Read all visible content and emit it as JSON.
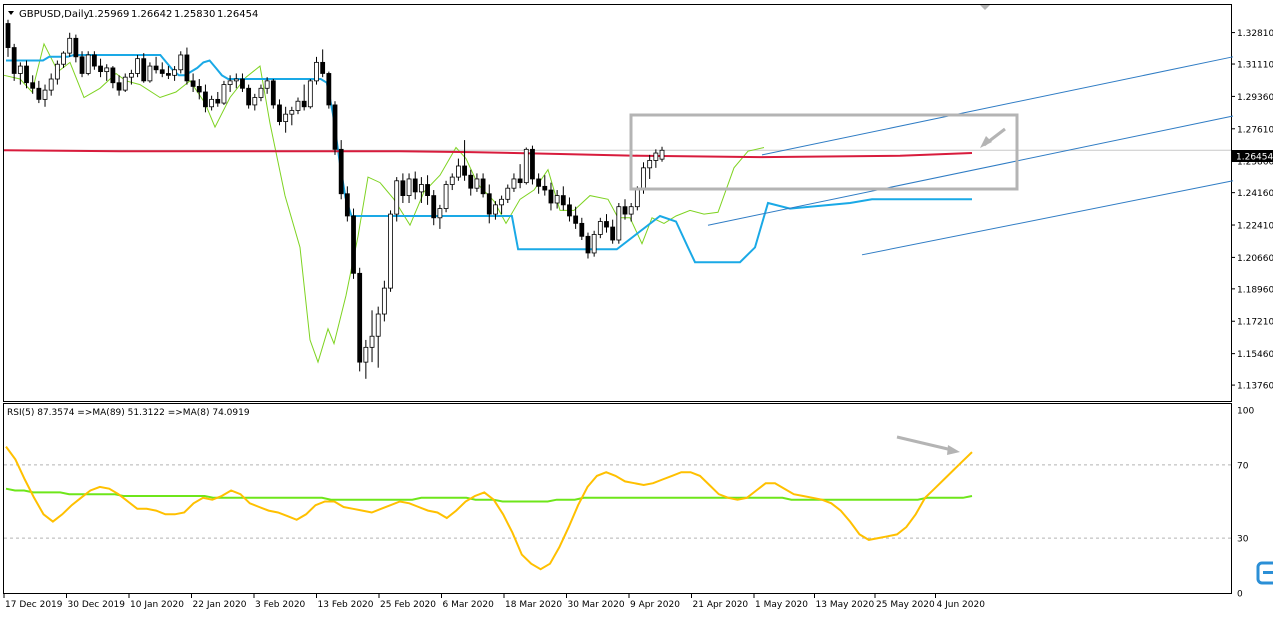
{
  "colors": {
    "background": "#ffffff",
    "frame": "#000000",
    "candle_up_fill": "#ffffff",
    "candle_down_fill": "#000000",
    "candle_outline": "#000000",
    "ma_red": "#d81b3c",
    "channel_cyan": "#1aa9e6",
    "green_line": "#7ed321",
    "trend_blue": "#2f7cc4",
    "rsi_line": "#ffc000",
    "rsi_ma": "#6ee61a",
    "box": "#b4b4b4",
    "arrow": "#b4b4b4",
    "price_badge_bg": "#000000",
    "price_badge_text": "#ffffff",
    "hline": "#c8c8c8"
  },
  "chart_data": [
    {
      "type": "candlestick",
      "title": "GBPUSD,Daily",
      "ohlc_header": [
        "1.25969",
        "1.26642",
        "1.25830",
        "1.26454"
      ],
      "ylim": [
        1.129,
        1.343
      ],
      "y_ticks": [
        "1.32810",
        "1.31110",
        "1.29360",
        "1.27610",
        "1.25860",
        "1.24160",
        "1.22410",
        "1.20660",
        "1.18960",
        "1.17210",
        "1.15460",
        "1.13760"
      ],
      "current_price": "1.26454",
      "x_ticks": [
        "17 Dec 2019",
        "30 Dec 2019",
        "10 Jan 2020",
        "22 Jan 2020",
        "3 Feb 2020",
        "13 Feb 2020",
        "25 Feb 2020",
        "6 Mar 2020",
        "18 Mar 2020",
        "30 Mar 2020",
        "9 Apr 2020",
        "21 Apr 2020",
        "1 May 2020",
        "13 May 2020",
        "25 May 2020",
        "4 Jun 2020"
      ],
      "candles_ohlc": [
        [
          1.333,
          1.335,
          1.315,
          1.32
        ],
        [
          1.32,
          1.322,
          1.302,
          1.306
        ],
        [
          1.306,
          1.312,
          1.3,
          1.31
        ],
        [
          1.31,
          1.313,
          1.298,
          1.301
        ],
        [
          1.301,
          1.305,
          1.295,
          1.298
        ],
        [
          1.298,
          1.302,
          1.29,
          1.292
        ],
        [
          1.292,
          1.3,
          1.288,
          1.297
        ],
        [
          1.297,
          1.306,
          1.294,
          1.303
        ],
        [
          1.303,
          1.313,
          1.3,
          1.311
        ],
        [
          1.311,
          1.318,
          1.309,
          1.317
        ],
        [
          1.317,
          1.328,
          1.315,
          1.325
        ],
        [
          1.325,
          1.327,
          1.312,
          1.315
        ],
        [
          1.315,
          1.318,
          1.304,
          1.306
        ],
        [
          1.306,
          1.318,
          1.305,
          1.316
        ],
        [
          1.316,
          1.318,
          1.308,
          1.31
        ],
        [
          1.31,
          1.314,
          1.304,
          1.307
        ],
        [
          1.307,
          1.311,
          1.302,
          1.309
        ],
        [
          1.309,
          1.31,
          1.298,
          1.301
        ],
        [
          1.301,
          1.305,
          1.294,
          1.297
        ],
        [
          1.297,
          1.306,
          1.296,
          1.304
        ],
        [
          1.304,
          1.308,
          1.3,
          1.306
        ],
        [
          1.306,
          1.316,
          1.304,
          1.314
        ],
        [
          1.314,
          1.317,
          1.301,
          1.302
        ],
        [
          1.302,
          1.312,
          1.301,
          1.31
        ],
        [
          1.31,
          1.315,
          1.306,
          1.308
        ],
        [
          1.308,
          1.312,
          1.304,
          1.306
        ],
        [
          1.306,
          1.31,
          1.303,
          1.305
        ],
        [
          1.305,
          1.31,
          1.302,
          1.308
        ],
        [
          1.308,
          1.318,
          1.306,
          1.316
        ],
        [
          1.316,
          1.32,
          1.3,
          1.302
        ],
        [
          1.302,
          1.306,
          1.296,
          1.299
        ],
        [
          1.299,
          1.303,
          1.292,
          1.296
        ],
        [
          1.296,
          1.3,
          1.285,
          1.288
        ],
        [
          1.288,
          1.294,
          1.286,
          1.292
        ],
        [
          1.292,
          1.296,
          1.288,
          1.29
        ],
        [
          1.29,
          1.302,
          1.289,
          1.3
        ],
        [
          1.3,
          1.305,
          1.296,
          1.302
        ],
        [
          1.302,
          1.306,
          1.298,
          1.303
        ],
        [
          1.303,
          1.306,
          1.296,
          1.298
        ],
        [
          1.298,
          1.3,
          1.287,
          1.289
        ],
        [
          1.289,
          1.295,
          1.286,
          1.293
        ],
        [
          1.293,
          1.3,
          1.291,
          1.298
        ],
        [
          1.298,
          1.304,
          1.295,
          1.302
        ],
        [
          1.302,
          1.303,
          1.287,
          1.289
        ],
        [
          1.289,
          1.292,
          1.278,
          1.28
        ],
        [
          1.28,
          1.288,
          1.274,
          1.284
        ],
        [
          1.284,
          1.288,
          1.278,
          1.286
        ],
        [
          1.286,
          1.293,
          1.284,
          1.291
        ],
        [
          1.291,
          1.3,
          1.286,
          1.288
        ],
        [
          1.288,
          1.303,
          1.287,
          1.302
        ],
        [
          1.302,
          1.315,
          1.3,
          1.312
        ],
        [
          1.312,
          1.319,
          1.304,
          1.306
        ],
        [
          1.306,
          1.307,
          1.287,
          1.289
        ],
        [
          1.289,
          1.291,
          1.262,
          1.265
        ],
        [
          1.265,
          1.27,
          1.238,
          1.241
        ],
        [
          1.241,
          1.245,
          1.226,
          1.229
        ],
        [
          1.229,
          1.233,
          1.195,
          1.198
        ],
        [
          1.198,
          1.201,
          1.145,
          1.15
        ],
        [
          1.15,
          1.162,
          1.141,
          1.158
        ],
        [
          1.158,
          1.178,
          1.15,
          1.164
        ],
        [
          1.164,
          1.18,
          1.147,
          1.176
        ],
        [
          1.176,
          1.194,
          1.172,
          1.19
        ],
        [
          1.19,
          1.232,
          1.188,
          1.23
        ],
        [
          1.23,
          1.25,
          1.226,
          1.248
        ],
        [
          1.248,
          1.252,
          1.236,
          1.24
        ],
        [
          1.24,
          1.252,
          1.236,
          1.249
        ],
        [
          1.249,
          1.253,
          1.238,
          1.242
        ],
        [
          1.242,
          1.25,
          1.236,
          1.246
        ],
        [
          1.246,
          1.251,
          1.235,
          1.24
        ],
        [
          1.24,
          1.243,
          1.224,
          1.228
        ],
        [
          1.228,
          1.235,
          1.222,
          1.233
        ],
        [
          1.233,
          1.248,
          1.231,
          1.246
        ],
        [
          1.246,
          1.252,
          1.243,
          1.25
        ],
        [
          1.25,
          1.26,
          1.248,
          1.256
        ],
        [
          1.256,
          1.27,
          1.248,
          1.251
        ],
        [
          1.251,
          1.254,
          1.24,
          1.244
        ],
        [
          1.244,
          1.252,
          1.242,
          1.249
        ],
        [
          1.249,
          1.252,
          1.239,
          1.241
        ],
        [
          1.241,
          1.246,
          1.225,
          1.23
        ],
        [
          1.23,
          1.237,
          1.227,
          1.235
        ],
        [
          1.235,
          1.24,
          1.23,
          1.238
        ],
        [
          1.238,
          1.246,
          1.236,
          1.244
        ],
        [
          1.244,
          1.252,
          1.242,
          1.249
        ],
        [
          1.249,
          1.257,
          1.244,
          1.247
        ],
        [
          1.247,
          1.266,
          1.246,
          1.265
        ],
        [
          1.265,
          1.267,
          1.246,
          1.249
        ],
        [
          1.249,
          1.252,
          1.241,
          1.245
        ],
        [
          1.245,
          1.251,
          1.24,
          1.243
        ],
        [
          1.243,
          1.247,
          1.232,
          1.236
        ],
        [
          1.236,
          1.243,
          1.233,
          1.24
        ],
        [
          1.24,
          1.245,
          1.232,
          1.235
        ],
        [
          1.235,
          1.239,
          1.226,
          1.229
        ],
        [
          1.229,
          1.234,
          1.222,
          1.225
        ],
        [
          1.225,
          1.228,
          1.216,
          1.218
        ],
        [
          1.218,
          1.22,
          1.206,
          1.209
        ],
        [
          1.209,
          1.221,
          1.207,
          1.219
        ],
        [
          1.219,
          1.228,
          1.217,
          1.226
        ],
        [
          1.226,
          1.23,
          1.22,
          1.223
        ],
        [
          1.223,
          1.227,
          1.214,
          1.216
        ],
        [
          1.216,
          1.236,
          1.214,
          1.234
        ],
        [
          1.234,
          1.238,
          1.227,
          1.23
        ],
        [
          1.23,
          1.236,
          1.226,
          1.234
        ],
        [
          1.234,
          1.245,
          1.232,
          1.243
        ],
        [
          1.243,
          1.258,
          1.241,
          1.255
        ],
        [
          1.255,
          1.262,
          1.249,
          1.259
        ],
        [
          1.259,
          1.265,
          1.255,
          1.263
        ],
        [
          1.2597,
          1.2664,
          1.2583,
          1.2645
        ]
      ],
      "ma_red": [
        1.2645,
        1.264,
        1.264,
        1.264,
        1.2625,
        1.2625,
        1.2625,
        1.261,
        1.261,
        1.261
      ],
      "channel_cyan": [
        1.313,
        1.313,
        1.313,
        1.313,
        1.313,
        1.313,
        1.313,
        1.315,
        1.315,
        1.315,
        1.315,
        1.316,
        1.316,
        1.316,
        1.316,
        1.316,
        1.316,
        1.316,
        1.316,
        1.316,
        1.316,
        1.316,
        1.316,
        1.316,
        1.316,
        1.316,
        1.312,
        1.308,
        1.305,
        1.305,
        1.307,
        1.309,
        1.312,
        1.313,
        1.309,
        1.305,
        1.303,
        1.303,
        1.303,
        1.303,
        1.303,
        1.303,
        1.303,
        1.303,
        1.303,
        1.303,
        1.303,
        1.303,
        1.303,
        1.303,
        1.303,
        1.303,
        1.301,
        1.284,
        1.26,
        1.239,
        1.229,
        1.229,
        1.229,
        1.229,
        1.229,
        1.229,
        1.229,
        1.229,
        1.229,
        1.229,
        1.229,
        1.229,
        1.229,
        1.229,
        1.229,
        1.229,
        1.229,
        1.229,
        1.229,
        1.229,
        1.229,
        1.229,
        1.229,
        1.229,
        1.229,
        1.229,
        1.229,
        1.211,
        1.211,
        1.211,
        1.211,
        1.211,
        1.211,
        1.211,
        1.211,
        1.211,
        1.211,
        1.211,
        1.211,
        1.211,
        1.211,
        1.211,
        1.211,
        1.211,
        1.211,
        1.211,
        1.211,
        1.211,
        1.211,
        1.211,
        1.211,
        1.211,
        1.211,
        1.211,
        1.211
      ],
      "rsi_label": "RSI(5) 87.3574 =>MA(89) 51.3122 =>MA(8) 74.0919",
      "rsi_ylim": [
        0,
        100
      ],
      "rsi_ticks": [
        "100",
        "70",
        "30",
        "0"
      ],
      "rsi_values": [
        80,
        73,
        62,
        52,
        43,
        39,
        43,
        48,
        52,
        56,
        58,
        57,
        54,
        50,
        46,
        46,
        45,
        43,
        43,
        44,
        49,
        52,
        51,
        53,
        56,
        54,
        49,
        47,
        45,
        44,
        42,
        40,
        43,
        48,
        50,
        50,
        47,
        46,
        45,
        44,
        46,
        48,
        50,
        49,
        47,
        45,
        44,
        41,
        45,
        50,
        53,
        55,
        51,
        43,
        33,
        21,
        16,
        13,
        16,
        25,
        36,
        48,
        58,
        64,
        66,
        64,
        61,
        60,
        59,
        60,
        62,
        64,
        66,
        66,
        64,
        59,
        54,
        52,
        51,
        52,
        56,
        60,
        60,
        57,
        54,
        53,
        52,
        51,
        49,
        45,
        39,
        32,
        29,
        30,
        31,
        32,
        36,
        43,
        52,
        57,
        62,
        67,
        72,
        77
      ],
      "rsi_ma": [
        57,
        56,
        56,
        55,
        55,
        55,
        55,
        54,
        54,
        54,
        54,
        54,
        54,
        53,
        53,
        53,
        53,
        53,
        53,
        53,
        53,
        53,
        53,
        52,
        52,
        52,
        52,
        52,
        52,
        52,
        52,
        52,
        52,
        52,
        52,
        52,
        51,
        51,
        51,
        51,
        51,
        51,
        51,
        51,
        51,
        51,
        52,
        52,
        52,
        52,
        52,
        52,
        51,
        51,
        51,
        50,
        50,
        50,
        50,
        50,
        50,
        51,
        51,
        51,
        52,
        52,
        52,
        52,
        52,
        52,
        52,
        52,
        52,
        52,
        52,
        52,
        52,
        52,
        52,
        52,
        52,
        52,
        52,
        52,
        52,
        52,
        52,
        51,
        51,
        51,
        51,
        51,
        51,
        51,
        51,
        51,
        51,
        51,
        51,
        51,
        51,
        51,
        52,
        52,
        52,
        52,
        52,
        53
      ]
    }
  ]
}
